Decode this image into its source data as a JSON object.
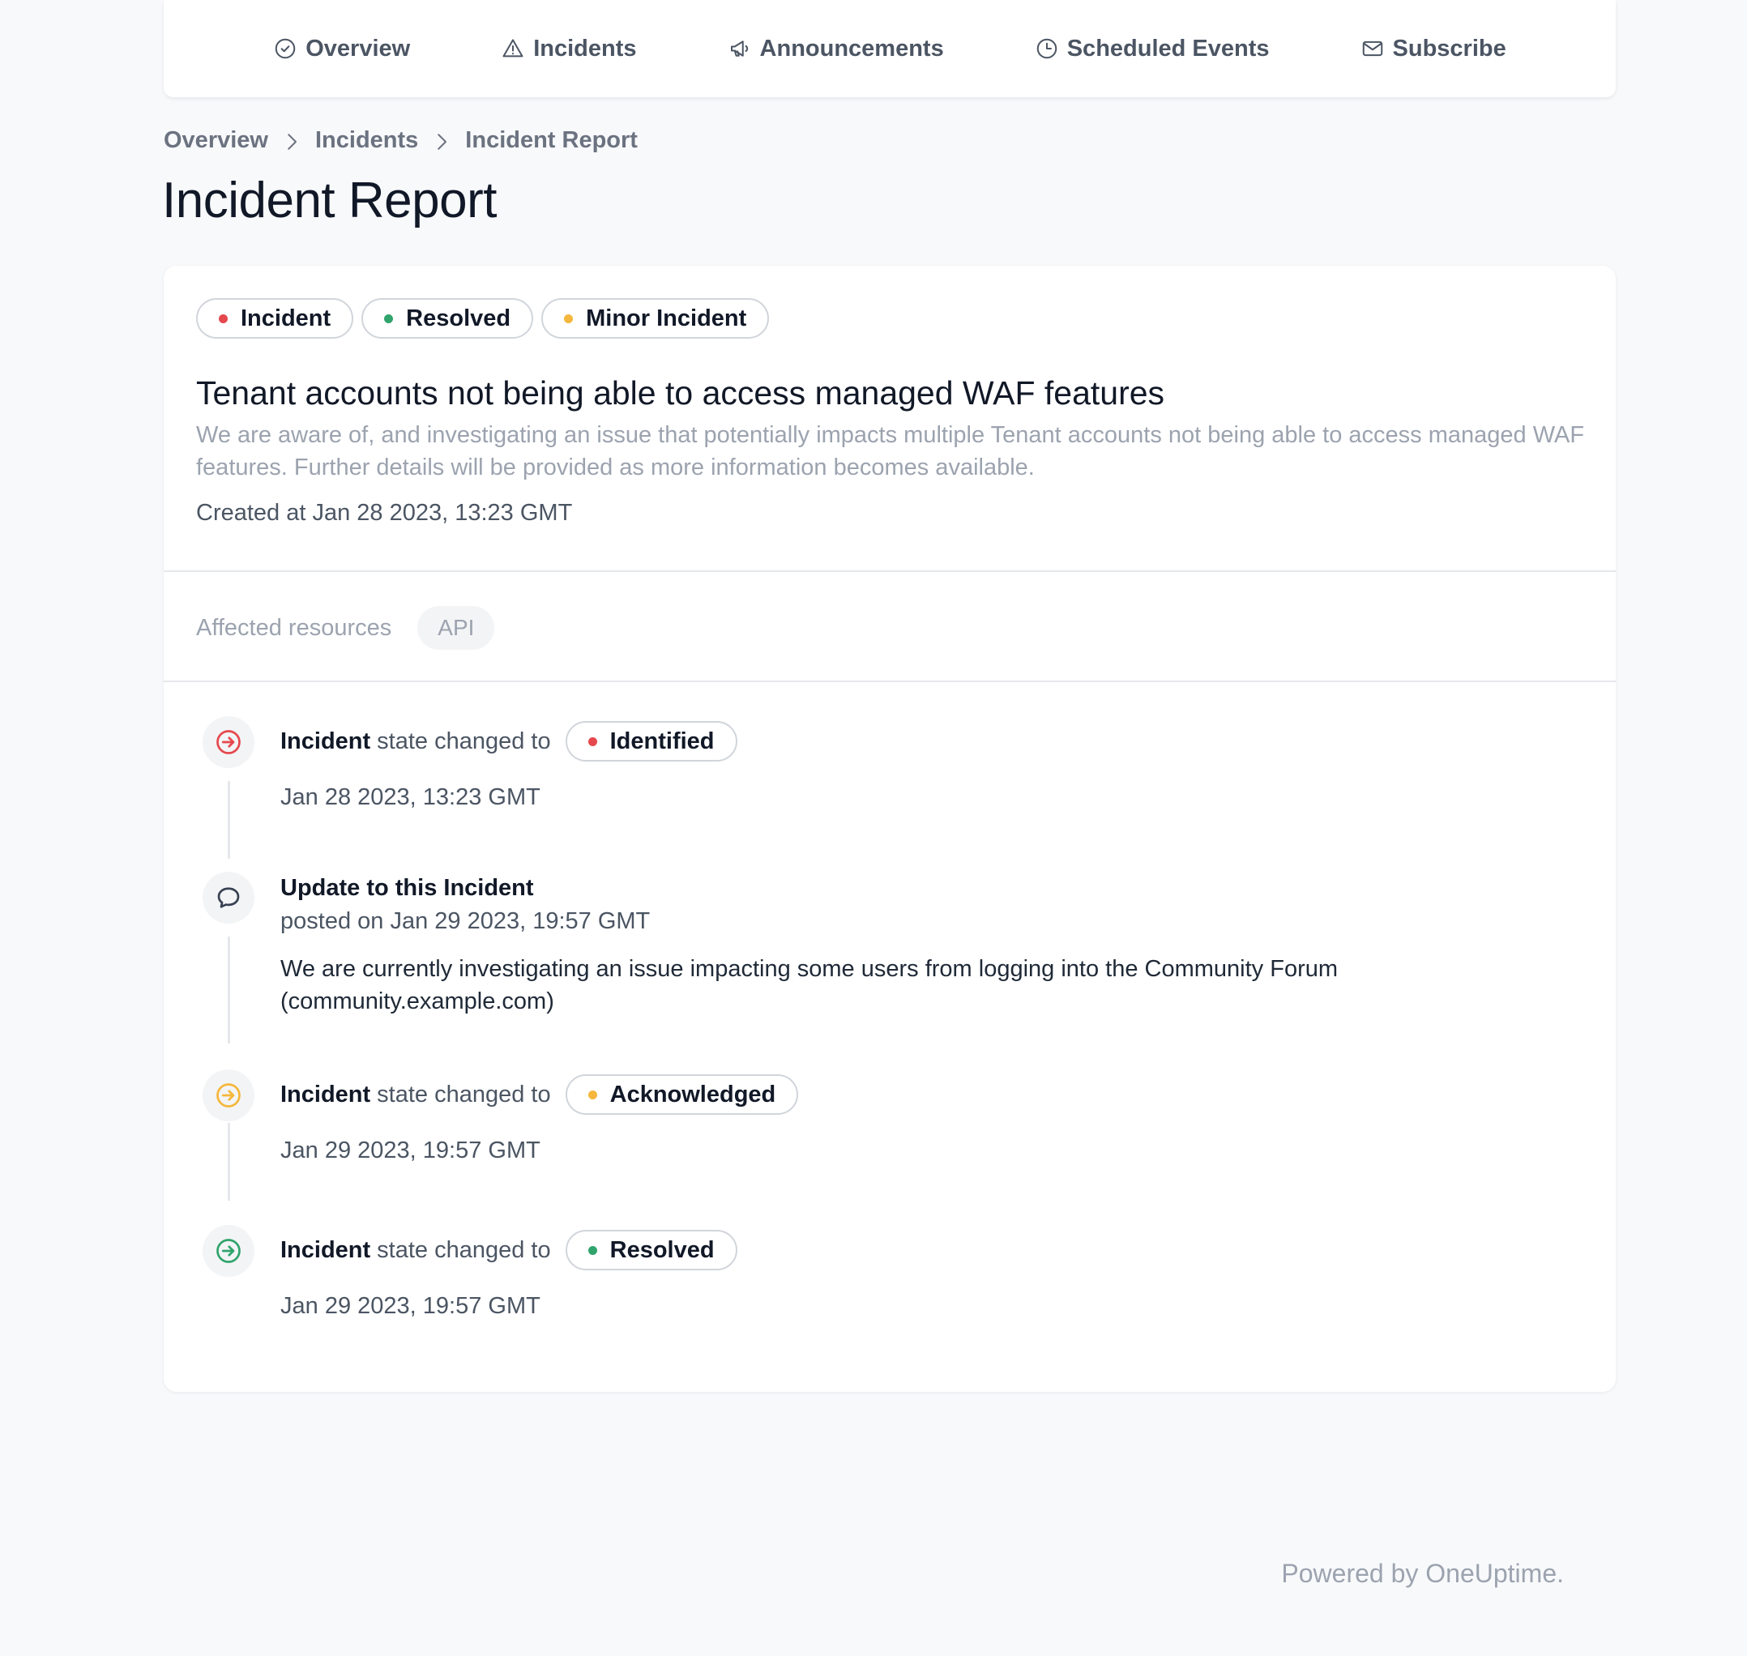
{
  "nav": {
    "items": [
      {
        "label": "Overview",
        "icon": "check-circle-icon"
      },
      {
        "label": "Incidents",
        "icon": "warning-triangle-icon"
      },
      {
        "label": "Announcements",
        "icon": "megaphone-icon"
      },
      {
        "label": "Scheduled Events",
        "icon": "clock-icon"
      },
      {
        "label": "Subscribe",
        "icon": "envelope-icon"
      }
    ]
  },
  "breadcrumb": [
    "Overview",
    "Incidents",
    "Incident Report"
  ],
  "page_title": "Incident Report",
  "incident": {
    "badges": [
      {
        "label": "Incident",
        "color": "#e5484d"
      },
      {
        "label": "Resolved",
        "color": "#30a46c"
      },
      {
        "label": "Minor Incident",
        "color": "#f5b73c"
      }
    ],
    "title": "Tenant accounts not being able to access managed WAF features",
    "description": "We are aware of, and investigating an issue that potentially impacts multiple Tenant accounts not being able to access managed WAF features. Further details will be provided as more information becomes available.",
    "created_at": "Created at Jan 28 2023, 13:23 GMT"
  },
  "affected": {
    "label": "Affected resources",
    "resources": [
      "API"
    ]
  },
  "timeline": {
    "state_prefix": "Incident",
    "state_text": "state changed to",
    "events": [
      {
        "kind": "state",
        "state": "Identified",
        "color": "#e5484d",
        "time": "Jan 28 2023, 13:23 GMT",
        "icon": "arrow-right-circle-icon"
      },
      {
        "kind": "note",
        "title": "Update to this Incident",
        "posted": "posted on Jan 29 2023, 19:57 GMT",
        "note": "We are currently investigating an issue impacting some users from logging into the Community Forum (community.example.com)",
        "icon": "chat-bubble-icon"
      },
      {
        "kind": "state",
        "state": "Acknowledged",
        "color": "#f5b73c",
        "time": "Jan 29 2023, 19:57 GMT",
        "icon": "arrow-right-circle-icon"
      },
      {
        "kind": "state",
        "state": "Resolved",
        "color": "#30a46c",
        "time": "Jan 29 2023, 19:57 GMT",
        "icon": "arrow-right-circle-icon"
      }
    ]
  },
  "footer": "Powered by OneUptime."
}
